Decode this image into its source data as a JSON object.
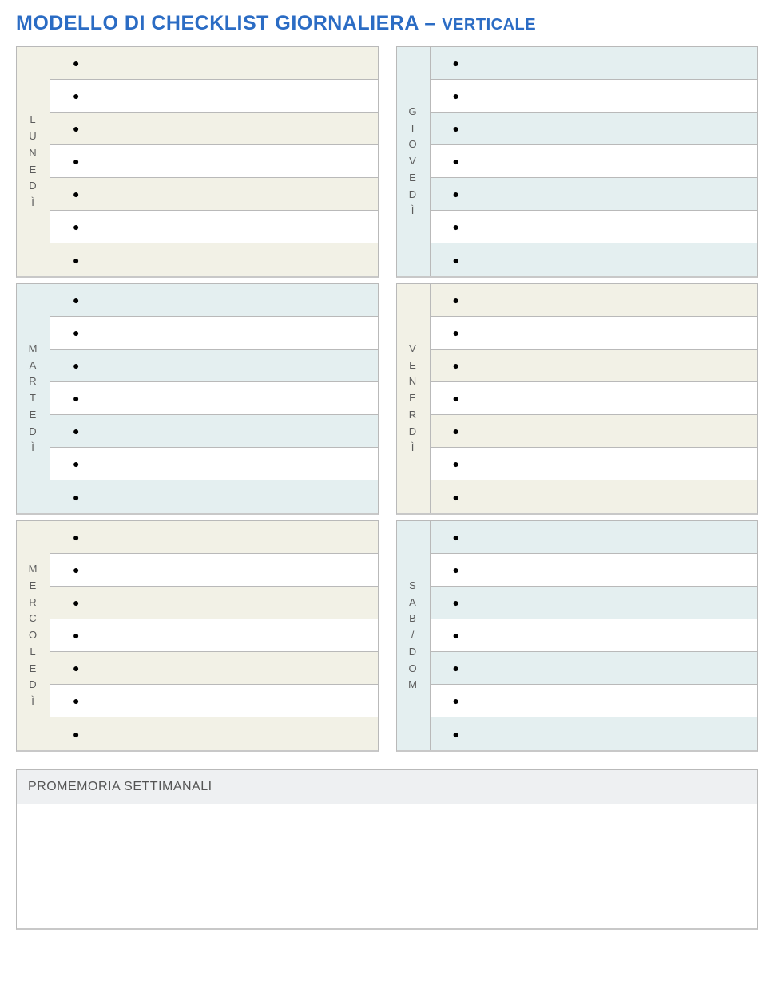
{
  "title_main": "MODELLO DI CHECKLIST GIORNALIERA",
  "title_sep": " – ",
  "title_sub": "VERTICALE",
  "colors": {
    "cream": "#f2f1e6",
    "blue": "#e4eff0",
    "heading": "#2b6cc4"
  },
  "rows_per_day": 7,
  "columns": [
    {
      "days": [
        {
          "key": "lun",
          "label": "LUNEDÌ",
          "label_bg": "cream",
          "alt_bg": "cream",
          "items": [
            "",
            "",
            "",
            "",
            "",
            "",
            ""
          ]
        },
        {
          "key": "mar",
          "label": "MARTEDÌ",
          "label_bg": "blue",
          "alt_bg": "blue",
          "items": [
            "",
            "",
            "",
            "",
            "",
            "",
            ""
          ]
        },
        {
          "key": "mer",
          "label": "MERCOLEDÌ",
          "label_bg": "cream",
          "alt_bg": "cream",
          "items": [
            "",
            "",
            "",
            "",
            "",
            "",
            ""
          ]
        }
      ]
    },
    {
      "days": [
        {
          "key": "gio",
          "label": "GIOVEDÌ",
          "label_bg": "blue",
          "alt_bg": "blue",
          "items": [
            "",
            "",
            "",
            "",
            "",
            "",
            ""
          ]
        },
        {
          "key": "ven",
          "label": "VENERDÌ",
          "label_bg": "cream",
          "alt_bg": "cream",
          "items": [
            "",
            "",
            "",
            "",
            "",
            "",
            ""
          ]
        },
        {
          "key": "sab",
          "label": "SAB/DOM",
          "label_bg": "blue",
          "alt_bg": "blue",
          "items": [
            "",
            "",
            "",
            "",
            "",
            "",
            ""
          ]
        }
      ]
    }
  ],
  "reminders": {
    "header": "PROMEMORIA SETTIMANALI",
    "body": ""
  }
}
